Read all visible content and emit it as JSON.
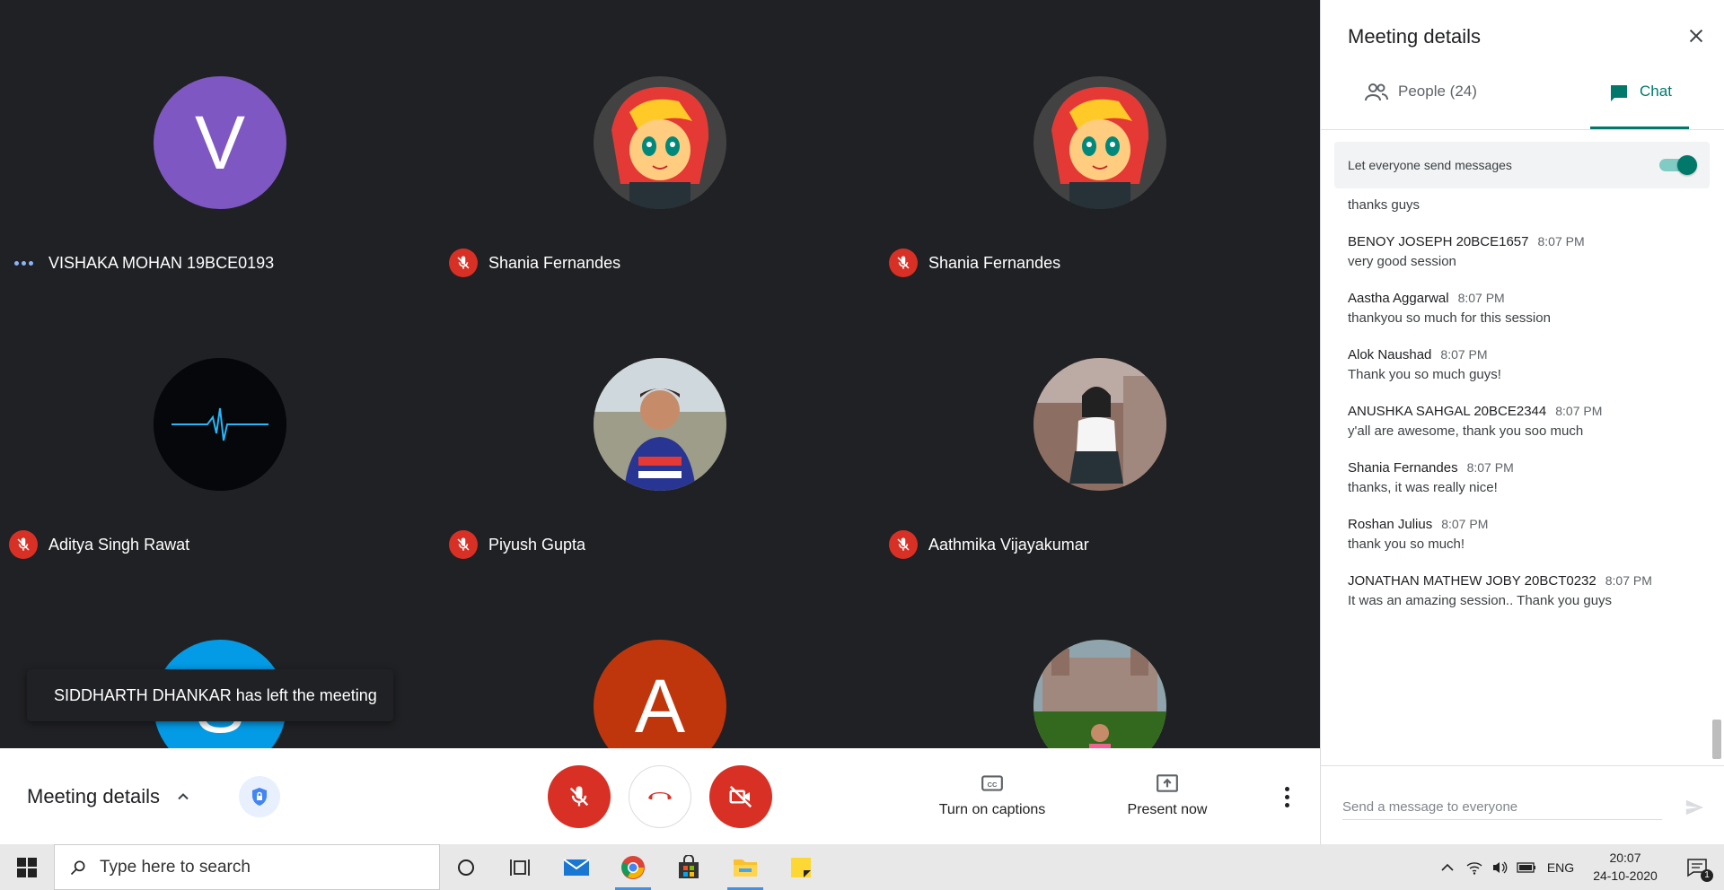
{
  "participants": [
    {
      "name": "VISHAKA MOHAN 19BCE0193",
      "avatar": "letter",
      "letter": "V",
      "color": "#7e57c2",
      "status": "speaking"
    },
    {
      "name": "Shania Fernandes",
      "avatar": "photo-cartoon",
      "status": "muted"
    },
    {
      "name": "Shania Fernandes",
      "avatar": "photo-cartoon",
      "status": "muted"
    },
    {
      "name": "Aditya Singh Rawat",
      "avatar": "photo-pulse",
      "status": "muted"
    },
    {
      "name": "Piyush Gupta",
      "avatar": "photo-person",
      "status": "muted"
    },
    {
      "name": "Aathmika Vijayakumar",
      "avatar": "photo-person",
      "status": "muted"
    },
    {
      "name": "",
      "avatar": "letter",
      "letter": "S",
      "color": "#039be5",
      "status": ""
    },
    {
      "name": "",
      "avatar": "letter",
      "letter": "A",
      "color": "#bf360c",
      "status": ""
    },
    {
      "name": "",
      "avatar": "photo-building",
      "status": ""
    }
  ],
  "toast": "SIDDHARTH DHANKAR has left the meeting",
  "bottom_bar": {
    "meeting_details_label": "Meeting details",
    "captions_label": "Turn on captions",
    "present_label": "Present now"
  },
  "panel": {
    "title": "Meeting details",
    "people_tab": "People (24)",
    "chat_tab": "Chat",
    "allow_messages_label": "Let everyone send messages",
    "allow_messages_on": true,
    "first_text": "thanks guys",
    "messages": [
      {
        "sender": "BENOY JOSEPH 20BCE1657",
        "time": "8:07 PM",
        "text": "very good session"
      },
      {
        "sender": "Aastha Aggarwal",
        "time": "8:07 PM",
        "text": "thankyou so much for this session"
      },
      {
        "sender": "Alok Naushad",
        "time": "8:07 PM",
        "text": "Thank you so much guys!"
      },
      {
        "sender": "ANUSHKA SAHGAL 20BCE2344",
        "time": "8:07 PM",
        "text": "y'all are awesome, thank you soo much"
      },
      {
        "sender": "Shania Fernandes",
        "time": "8:07 PM",
        "text": "thanks, it was really nice!"
      },
      {
        "sender": "Roshan Julius",
        "time": "8:07 PM",
        "text": "thank you so much!"
      },
      {
        "sender": "JONATHAN MATHEW JOBY 20BCT0232",
        "time": "8:07 PM",
        "text": "It was an amazing session.. Thank you guys"
      }
    ],
    "input_placeholder": "Send a message to everyone"
  },
  "taskbar": {
    "search_placeholder": "Type here to search",
    "language": "ENG",
    "time": "20:07",
    "date": "24-10-2020",
    "notification_count": "1"
  },
  "colors": {
    "accent_teal": "#00796b",
    "mute_red": "#d93025"
  }
}
